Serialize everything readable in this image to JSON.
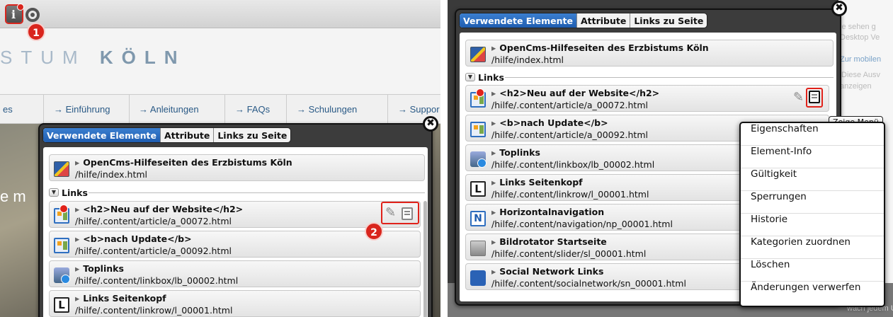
{
  "left": {
    "site": {
      "logo_light": "STUM",
      "logo_bold": "KÖLN",
      "nav": [
        "es",
        "→ Einführung",
        "→ Anleitungen",
        "→ FAQs",
        "→ Schulungen",
        "→ Suppor"
      ],
      "hero_text": "e m"
    },
    "steps": [
      "1",
      "2"
    ],
    "dialog": {
      "close": "✖",
      "tabs": [
        "Verwendete Elemente",
        "Attribute",
        "Links zu Seite"
      ],
      "page": {
        "title": "OpenCms-Hilfeseiten des Erzbistums Köln",
        "path": "/hilfe/index.html"
      },
      "section": "Links",
      "items": [
        {
          "title": "<h2>Neu auf der Website</h2>",
          "path": "/hilfe/.content/article/a_00072.html"
        },
        {
          "title": "<b>nach Update</b>",
          "path": "/hilfe/.content/article/a_00092.html"
        },
        {
          "title": "Toplinks",
          "path": "/hilfe/.content/linkbox/lb_00002.html"
        },
        {
          "title": "Links Seitenkopf",
          "path": "/hilfe/.content/linkrow/l_00001.html"
        }
      ]
    }
  },
  "right": {
    "background_texts": [
      "ie sehen g",
      "Desktop Ve",
      "Zur mobilen",
      "Diese Ausv",
      "anzeigen",
      "wach jedem U"
    ],
    "dialog": {
      "close": "✖",
      "tabs": [
        "Verwendete Elemente",
        "Attribute",
        "Links zu Seite"
      ],
      "page": {
        "title": "OpenCms-Hilfeseiten des Erzbistums Köln",
        "path": "/hilfe/index.html"
      },
      "section": "Links",
      "items": [
        {
          "title": "<h2>Neu auf der Website</h2>",
          "path": "/hilfe/.content/article/a_00072.html"
        },
        {
          "title": "<b>nach Update</b>",
          "path": "/hilfe/.content/article/a_00092.html"
        },
        {
          "title": "Toplinks",
          "path": "/hilfe/.content/linkbox/lb_00002.html"
        },
        {
          "title": "Links Seitenkopf",
          "path": "/hilfe/.content/linkrow/l_00001.html"
        },
        {
          "title": "Horizontalnavigation",
          "path": "/hilfe/.content/navigation/np_00001.html"
        },
        {
          "title": "Bildrotator Startseite",
          "path": "/hilfe/.content/slider/sl_00001.html"
        },
        {
          "title": "Social Network Links",
          "path": "/hilfe/.content/socialnetwork/sn_00001.html"
        }
      ]
    },
    "tooltip": "Zeige Menü",
    "context_menu": [
      "Eigenschaften",
      "Element-Info",
      "Gültigkeit",
      "Sperrungen",
      "Historie",
      "Kategorien zuordnen",
      "Löschen",
      "Änderungen verwerfen"
    ]
  },
  "colors": {
    "accent": "#1f5db0",
    "marker": "#d9251d"
  }
}
